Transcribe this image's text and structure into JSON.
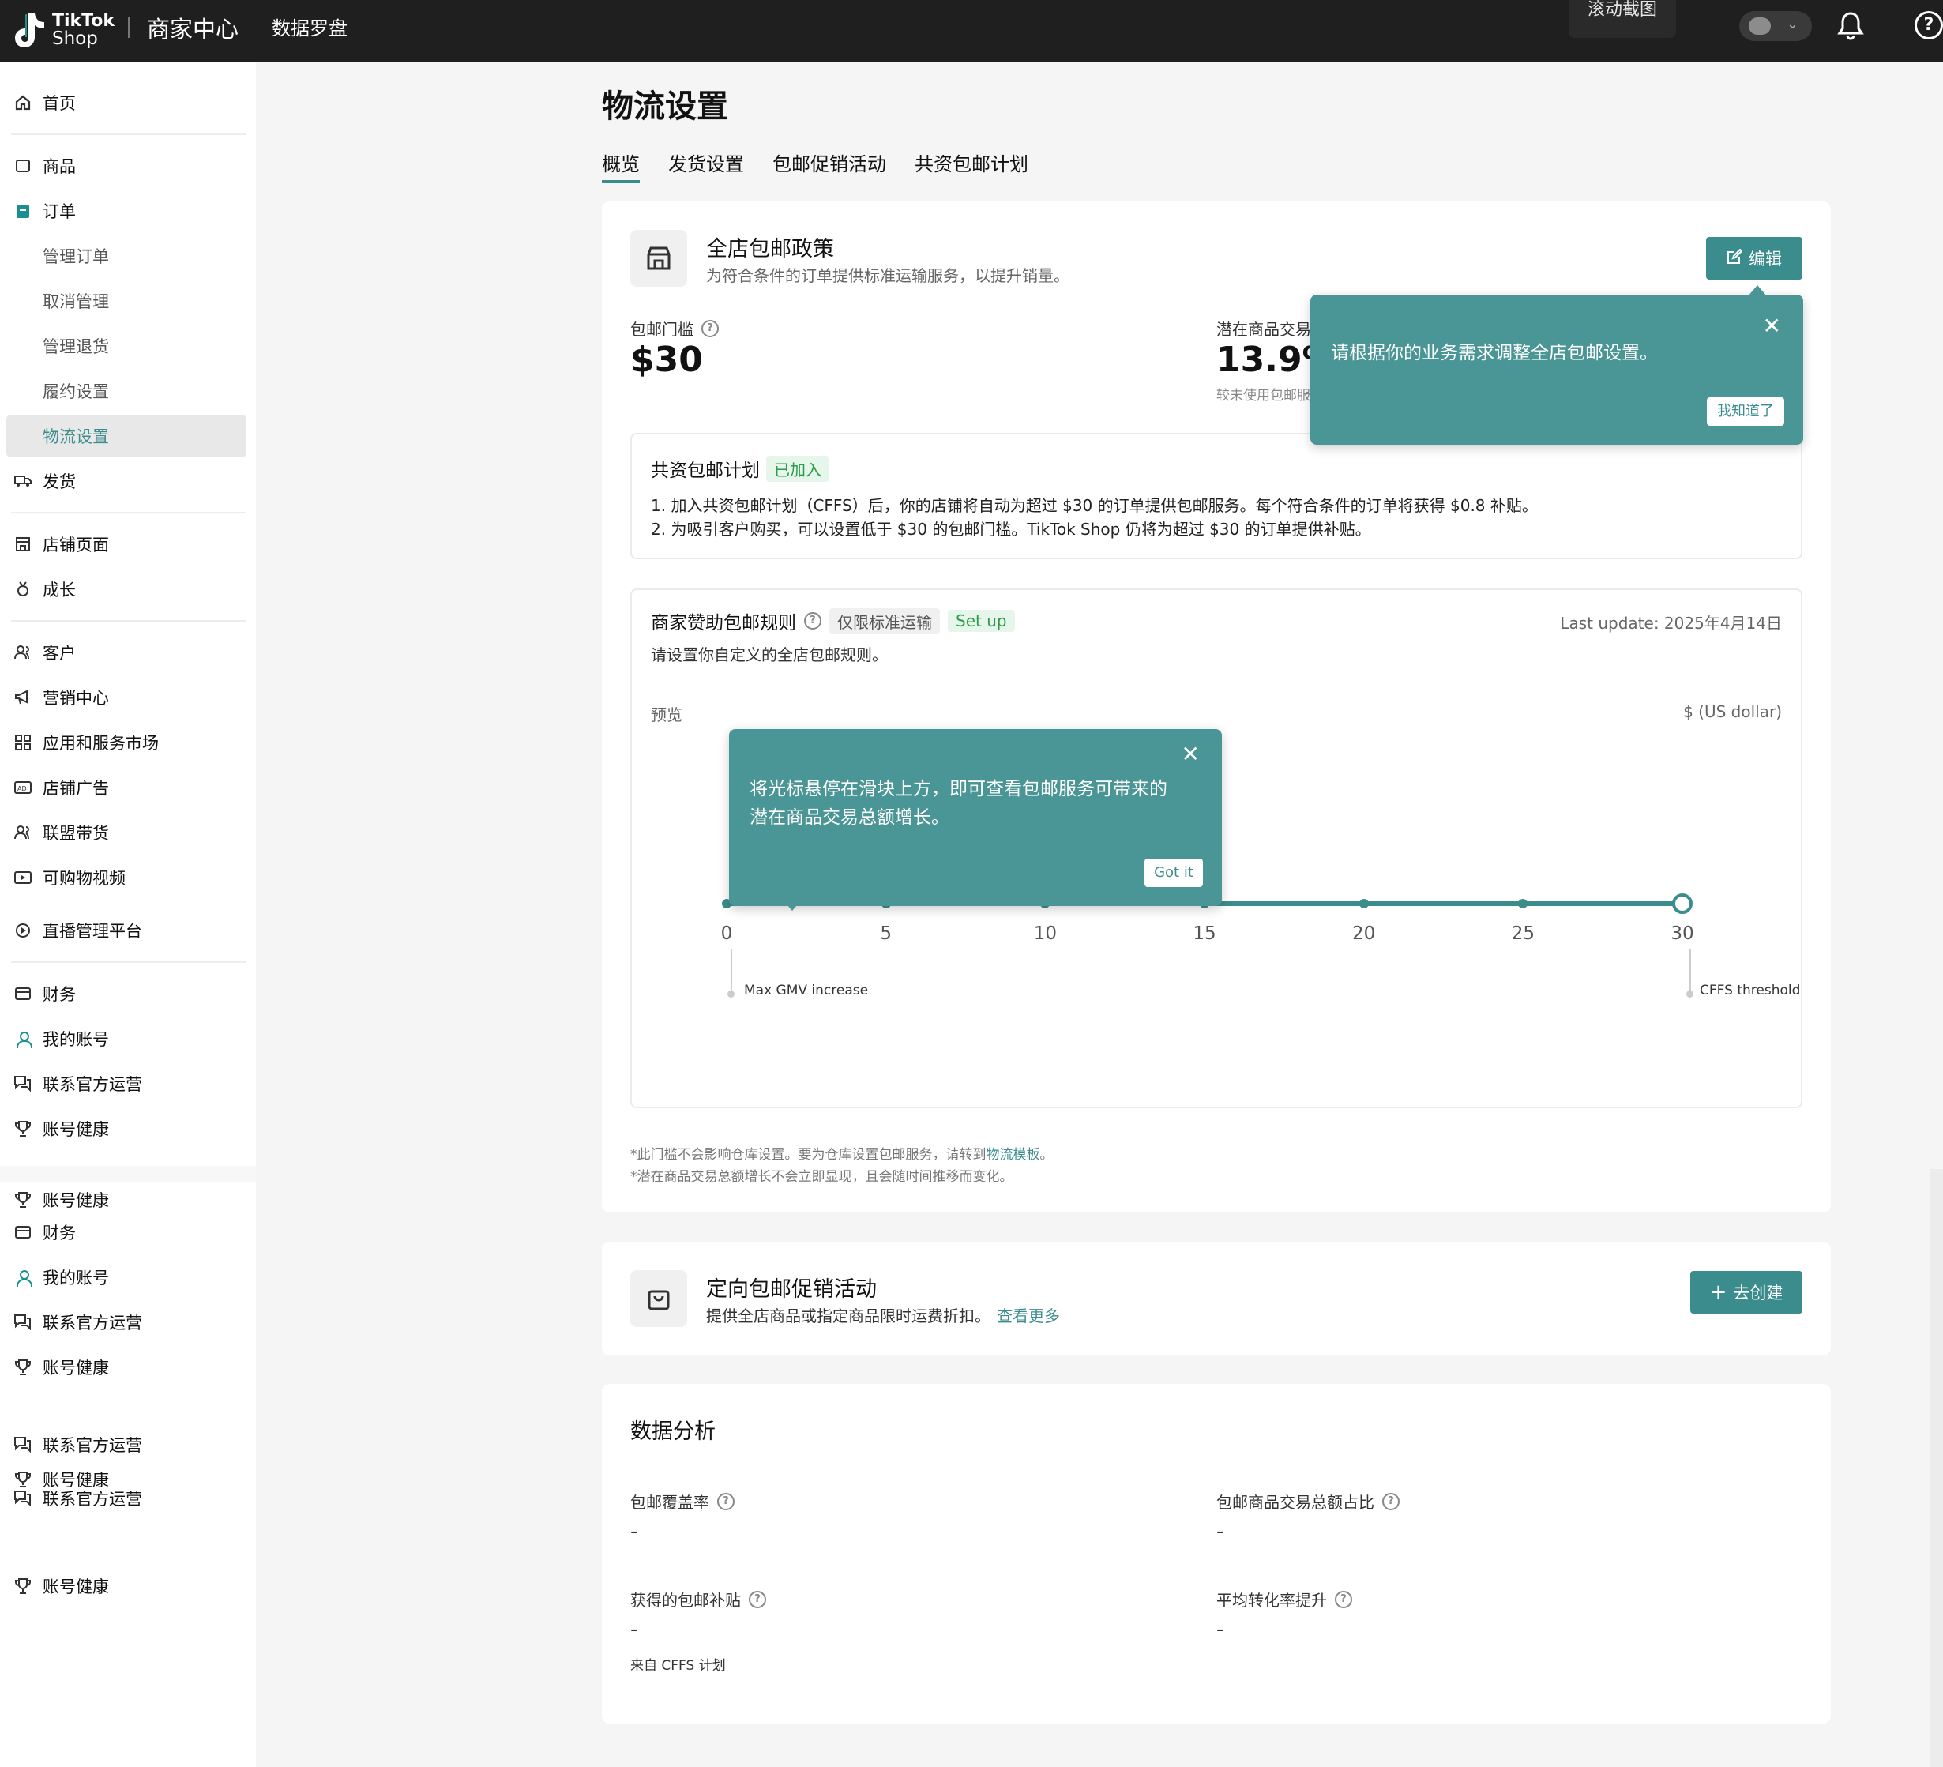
{
  "topbar": {
    "logo_line1": "TikTok",
    "logo_line2": "Shop",
    "center_title": "商家中心",
    "compass": "数据罗盘",
    "scroll_capture": "滚动截图",
    "help": "?"
  },
  "sidebar": {
    "home": "首页",
    "products": "商品",
    "orders": "订单",
    "manage_orders": "管理订单",
    "cancel_manage": "取消管理",
    "manage_returns": "管理退货",
    "fulfillment_settings": "履约设置",
    "logistics_settings": "物流设置",
    "shipping": "发货",
    "store_page": "店铺页面",
    "growth": "成长",
    "customers": "客户",
    "marketing": "营销中心",
    "app_market": "应用和服务市场",
    "store_ads": "店铺广告",
    "affiliate": "联盟带货",
    "shoppable_video": "可购物视频",
    "live": "直播管理平台",
    "finance": "财务",
    "my_account": "我的账号",
    "contact_ops": "联系官方运营",
    "account_health": "账号健康",
    "dup_account_health_1": "账号健康",
    "dup_finance": "财务",
    "dup_my_account": "我的账号",
    "dup_contact_ops_1": "联系官方运营",
    "dup_account_health_2": "账号健康",
    "dup_contact_ops_2": "联系官方运营",
    "dup_account_health_3": "账号健康",
    "dup_contact_ops_3": "联系官方运营",
    "dup_account_health_4": "账号健康"
  },
  "page": {
    "title": "物流设置",
    "tabs": [
      "概览",
      "发货设置",
      "包邮促销活动",
      "共资包邮计划"
    ]
  },
  "store_policy": {
    "title": "全店包邮政策",
    "subtitle": "为符合条件的订单提供标准运输服务，以提升销量。",
    "edit": "编辑",
    "threshold_label": "包邮门槛",
    "threshold_value": "$30",
    "gmv_label": "潜在商品交易",
    "gmv_value": "13.9%",
    "gmv_note": "较未使用包邮服",
    "tooltip_text": "请根据你的业务需求调整全店包邮设置。",
    "tooltip_ok": "我知道了"
  },
  "cffs": {
    "title": "共资包邮计划",
    "status": "已加入",
    "line1": "1. 加入共资包邮计划（CFFS）后，你的店铺将自动为超过 $30 的订单提供包邮服务。每个符合条件的订单将获得 $0.8 补贴。",
    "line2": "2. 为吸引客户购买，可以设置低于 $30 的包邮门槛。TikTok Shop 仍将为超过 $30 的订单提供补贴。"
  },
  "rules": {
    "title": "商家赞助包邮规则",
    "tag_standard": "仅限标准运输",
    "tag_setup": "Set up",
    "last_update": "Last update: 2025年4月14日",
    "subtitle": "请设置你自定义的全店包邮规则。",
    "preview": "预览",
    "unit": "$ (US dollar)",
    "tooltip_text_1": "将光标悬停在滑块上方，即可查看包邮服务可带来的",
    "tooltip_text_2": "潜在商品交易总额增长。",
    "tooltip_ok": "Got it",
    "slider_ticks": [
      "0",
      "5",
      "10",
      "15",
      "20",
      "25",
      "30"
    ],
    "slider_value": 30,
    "slider_min": 0,
    "slider_max": 30,
    "marker_left": "Max GMV increase",
    "marker_right": "CFFS threshold"
  },
  "footnotes": {
    "note1_pre": "*此门槛不会影响仓库设置。要为仓库设置包邮服务，请转到",
    "note1_link": "物流模板",
    "note1_post": "。",
    "note2": "*潜在商品交易总额增长不会立即显现，且会随时间推移而变化。"
  },
  "targeted": {
    "title": "定向包邮促销活动",
    "subtitle": "提供全店商品或指定商品限时运费折扣。",
    "link": "查看更多",
    "create": "去创建"
  },
  "analytics": {
    "title": "数据分析",
    "coverage_label": "包邮覆盖率",
    "coverage_value": "-",
    "gmv_share_label": "包邮商品交易总额占比",
    "gmv_share_value": "-",
    "subsidy_label": "获得的包邮补贴",
    "subsidy_value": "-",
    "subsidy_note": "来自 CFFS 计划",
    "conv_label": "平均转化率提升",
    "conv_value": "-"
  },
  "colors": {
    "accent": "#3b8d8d",
    "popover": "#4a9595",
    "topbar": "#1f1f1f",
    "tag_green": "#2c9b4a"
  }
}
